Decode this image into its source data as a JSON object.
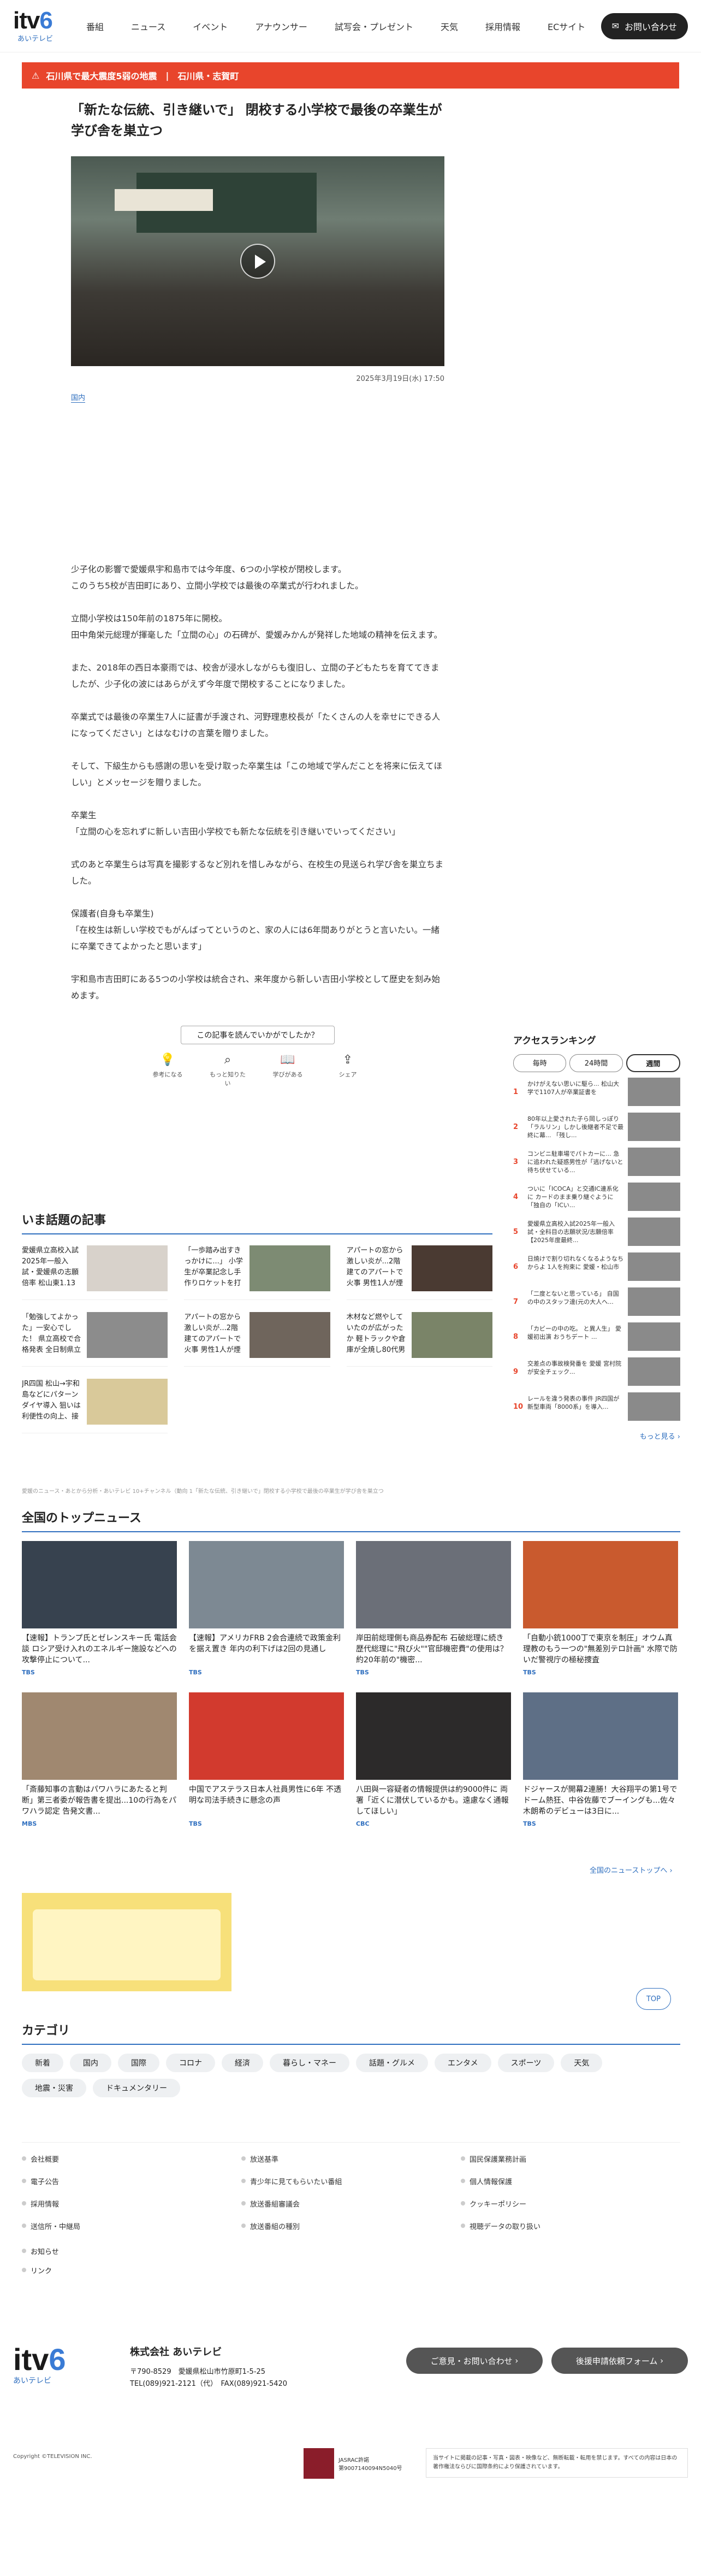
{
  "header": {
    "logo_text": "itv",
    "logo_six": "6",
    "logo_sub": "あいテレビ",
    "nav": [
      "番組",
      "ニュース",
      "イベント",
      "アナウンサー",
      "試写会・プレゼント",
      "天気",
      "採用情報",
      "ECサイト"
    ],
    "contact_label": "お問い合わせ"
  },
  "alert": {
    "items": [
      "石川県で最大震度5弱の地震",
      "石川県・志賀町"
    ]
  },
  "article": {
    "title": "「新たな伝統、引き継いで」 閉校する小学校で最後の卒業生が学び舎を巣立つ",
    "date": "2025年3月19日(水) 17:50",
    "tag": "国内",
    "paragraphs": [
      "少子化の影響で愛媛県宇和島市では今年度、6つの小学校が閉校します。\nこのうち5校が吉田町にあり、立間小学校では最後の卒業式が行われました。",
      "立間小学校は150年前の1875年に開校。\n田中角栄元総理が揮毫した「立間の心」の石碑が、愛媛みかんが発祥した地域の精神を伝えます。",
      "また、2018年の西日本豪雨では、校舎が浸水しながらも復旧し、立間の子どもたちを育ててきましたが、少子化の波にはあらがえず今年度で閉校することになりました。",
      "卒業式では最後の卒業生7人に証書が手渡され、河野理恵校長が「たくさんの人を幸せにできる人になってください」とはなむけの言葉を贈りました。",
      "そして、下級生からも感謝の思いを受け取った卒業生は「この地域で学んだことを将来に伝えてほしい」とメッセージを贈りました。",
      "卒業生\n「立間の心を忘れずに新しい吉田小学校でも新たな伝統を引き継いでいってください」",
      "式のあと卒業生らは写真を撮影するなど別れを惜しみながら、在校生の見送られ学び舎を巣立ちました。",
      "保護者(自身も卒業生)\n「在校生は新しい学校でもがんばってというのと、家の人には6年間ありがとうと言いたい。一緒に卒業できてよかったと思います」",
      "宇和島市吉田町にある5つの小学校は統合され、来年度から新しい吉田小学校として歴史を刻み始めます。"
    ],
    "reaction_question": "この記事を読んでいかがでしたか？",
    "reactions": [
      "参考になる",
      "もっと知りたい",
      "学びがある",
      "シェア"
    ]
  },
  "ranking": {
    "title": "アクセスランキング",
    "tabs": [
      "毎時",
      "24時間",
      "週間"
    ],
    "items": [
      "かけがえない思いに駆ら... 松山大学で1107人が卒業証書を",
      "80年以上愛された子ら岡しっぽり「ラルリン」しかし後継者不足で最終に幕... 「残し...",
      "コンビニ駐車場でパトカーに... 急に追われた疑惑男性が「逃げないと待ち伏せている...",
      "ついに「ICOCA」と交通IC連系化に カードのまま乗り継ぐように「独自の「ICい...",
      "愛媛県立高校入試2025年一般入試・全科目の志願状況/志願倍率【2025年度最終...",
      "日焼けで割り切れなくなるようなちからよ 1人を拘束に 愛媛・松山市",
      "「二度とないと思っている」 自国の中のスタッフ達(元の大人へ...",
      "「カビーの中の吃。 と異人生」 愛媛初出演 おうちデート ...",
      "交差点の事故検発番を 愛媛 宮村院が安全チェック...",
      "レールを違う発表の事件 JR四国が新型車両「8000系」を導入..."
    ],
    "more": "もっと見る"
  },
  "hot": {
    "title": "いま話題の記事",
    "items": [
      "愛媛県立高校入試2025年一般入試・愛媛県の志願倍率 松山東1.13倍 松山南1.03倍 松...",
      "「一歩踏み出すきっかけに...」 小学生が卒業記念し手作りロケットを打ち上げ",
      "アパートの窓から激しい炎が...2階建てのアパートで火事 男性1人が煙を吸い救急搬...",
      "「勉強してよかった」一安心でした！ 県立高校で合格発表 全日制県立高校の4分の3...",
      "アパートの窓から激しい炎が...2階建てのアパートで火事 男性1人が煙を吸い救急搬...",
      "木材など燃やしていたのが広がったか 軽トラックや倉庫が全焼し80代男性が軽いやけ...",
      "JR四国 松山→宇和島などにパターンダイヤ導入 狙いは利便性の向上、接続する他の公..."
    ],
    "caption": "愛媛のニュース・あとから分析・あいテレビ 10+チャンネル（動向 1「新たな伝統、引き継いで」閉校する小学校で最後の卒業生が学び舎を巣立つ"
  },
  "topnews": {
    "title": "全国のトップニュース",
    "items": [
      {
        "text": "【速報】トランプ氏とゼレンスキー氏 電話会談 ロシア受け入れのエネルギー施設などへの攻撃停止について...",
        "src": "TBS"
      },
      {
        "text": "【速報】アメリカFRB 2会合連続で政策金利を据え置き 年内の利下げは2回の見通し",
        "src": "TBS"
      },
      {
        "text": "岸田前総理側も商品券配布 石破総理に続き歴代総理に\"飛び火\"\"官邸機密費\"の使用は？ 約20年前の\"機密...",
        "src": "TBS"
      },
      {
        "text": "「自動小銃1000丁で東京を制圧」オウム真理教のもう一つの\"無差別テロ計画\" 水際で防いだ警視庁の極秘捜査",
        "src": "TBS"
      },
      {
        "text": "「斎藤知事の言動はパワハラにあたると判断」第三者委が報告書を提出...10の行為をパワハラ認定 告発文書...",
        "src": "MBS"
      },
      {
        "text": "中国でアステラス日本人社員男性に6年 不透明な司法手続きに懸念の声",
        "src": "TBS"
      },
      {
        "text": "八田與一容疑者の情報提供は約9000件に 両署「近くに潜伏しているかも。遠慮なく通報してほしい」",
        "src": "CBC"
      },
      {
        "text": "ドジャースが開幕2連勝！大谷翔平の第1号でドーム熱狂、中谷佐藤でブーイングも...佐々木朗希のデビューは3日に...",
        "src": "TBS"
      }
    ],
    "more": "全国のニューストップへ"
  },
  "to_top": "TOP",
  "category": {
    "title": "カテゴリ",
    "chips": [
      "新着",
      "国内",
      "国際",
      "コロナ",
      "経済",
      "暮らし・マネー",
      "話題・グルメ",
      "エンタメ",
      "スポーツ",
      "天気",
      "地震・災害",
      "ドキュメンタリー"
    ]
  },
  "footer": {
    "links": [
      "会社概要",
      "放送基準",
      "国民保護業務計画",
      "電子公告",
      "青少年に見てもらいたい番組",
      "個人情報保護",
      "採用情報",
      "放送番組審議会",
      "クッキーポリシー",
      "送信所・中継局",
      "放送番組の種別",
      "視聴データの取り扱い"
    ],
    "links2": [
      "お知らせ",
      "リンク"
    ],
    "company_name": "株式会社 あいテレビ",
    "address": "〒790-8529　愛媛県松山市竹原町1-5-25",
    "tel": "TEL(089)921-2121（代）　FAX(089)921-5420",
    "btn_contact": "ご意見・お問い合わせ",
    "btn_form": "後援申請依頼フォーム",
    "copyright": "Copyright ©TELEVISION INC.",
    "jasrac": "JASRAC許諾\n第9007140094N5040号",
    "notice": "当サイトに掲載の記事・写真・図表・映像など、無断転載・転用を禁じます。すべての内容は日本の著作権法ならびに国際条約により保護されています。"
  }
}
